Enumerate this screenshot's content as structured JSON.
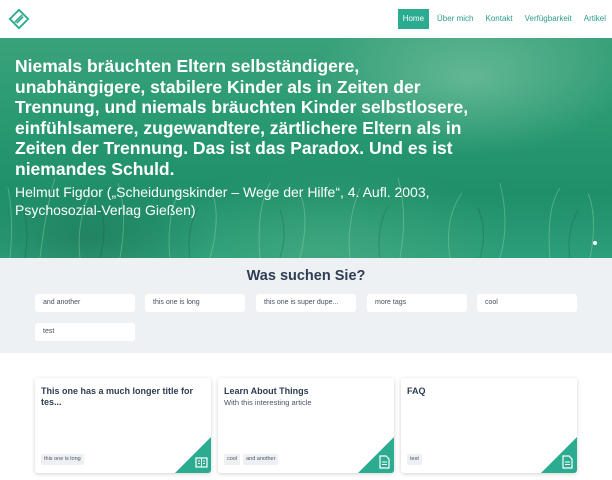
{
  "header": {
    "logo_icon": "diamond-link-logo",
    "nav": [
      {
        "label": "Home",
        "active": true
      },
      {
        "label": "Über mich",
        "active": false
      },
      {
        "label": "Kontakt",
        "active": false
      },
      {
        "label": "Verfügbarkeit",
        "active": false
      },
      {
        "label": "Artikel",
        "active": false
      }
    ]
  },
  "hero": {
    "quote": "Niemals bräuchten Eltern selbständigere, unabhängigere, stabilere Kinder als in Zeiten der Trennung, und niemals bräuchten Kinder selbstlosere, einfühlsamere, zugewandtere, zärtlichere Eltern als in Zeiten der Trennung. Das ist das Paradox. Und es ist niemandes Schuld.",
    "source": "Helmut Figdor („Scheidungskinder – Wege der Hilfe“, 4. Aufl. 2003, Psychosozial-Verlag Gießen)"
  },
  "search": {
    "title": "Was suchen Sie?",
    "tags": [
      "and another",
      "this one is long",
      "this one is super dupe...",
      "more tags",
      "cool",
      "test"
    ]
  },
  "cards": [
    {
      "title": "This one has a much longer title for tes...",
      "subtitle": "",
      "tags": [
        "this one is long"
      ],
      "icon": "article-icon"
    },
    {
      "title": "Learn About Things",
      "subtitle": "With this interesting article",
      "tags": [
        "cool",
        "and another"
      ],
      "icon": "document-icon"
    },
    {
      "title": "FAQ",
      "subtitle": "",
      "tags": [
        "test"
      ],
      "icon": "document-icon"
    }
  ],
  "colors": {
    "accent": "#2bab8f",
    "hero": "#2a9a73",
    "section_bg": "#eef1f4"
  }
}
